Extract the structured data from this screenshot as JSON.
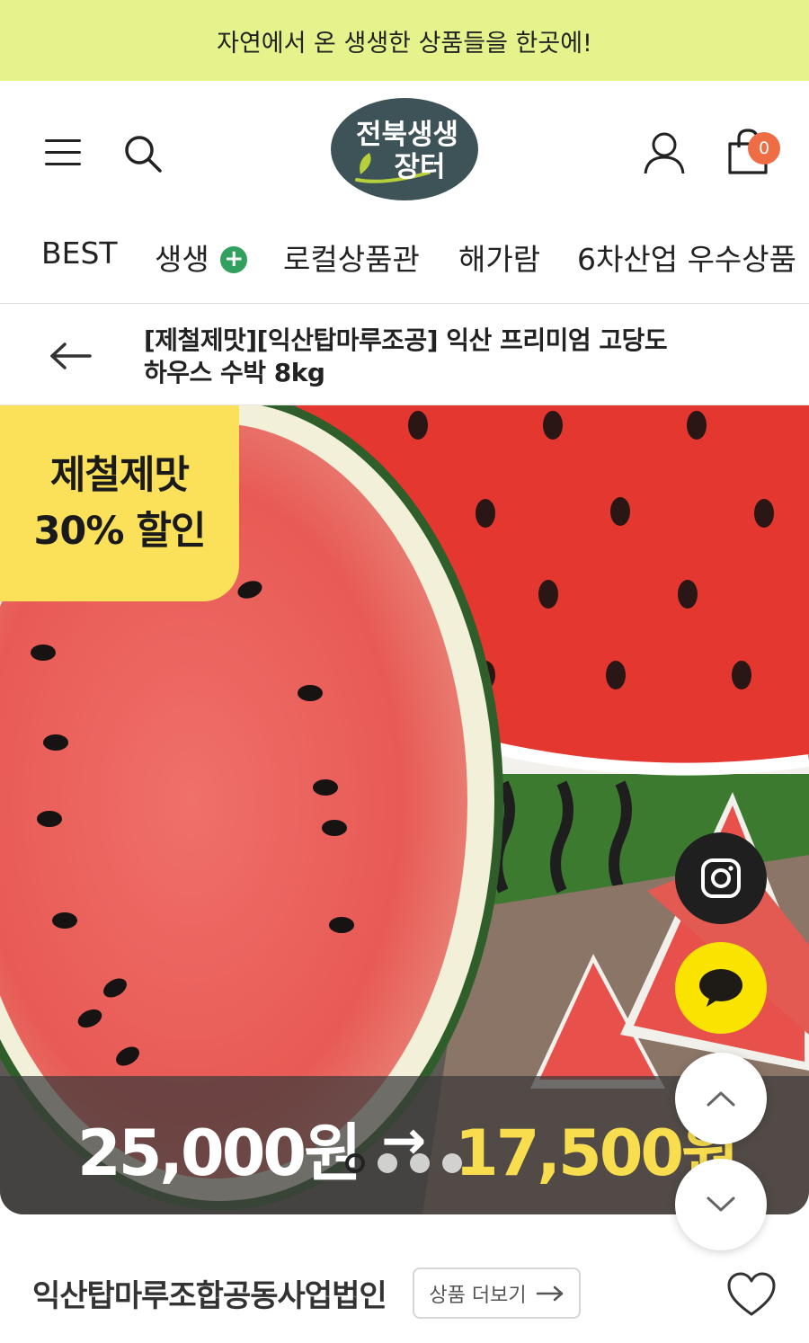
{
  "banner": {
    "text": "자연에서 온 생생한 상품들을 한곳에!"
  },
  "header": {
    "logo_text_line1": "전북생생",
    "logo_text_line2": "장터",
    "cart_count": "0"
  },
  "nav": {
    "items": [
      {
        "label": "BEST"
      },
      {
        "label": "생생",
        "badge": "+"
      },
      {
        "label": "로컬상품관"
      },
      {
        "label": "해가람"
      },
      {
        "label": "6차산업 우수상품"
      }
    ]
  },
  "product": {
    "title": "[제철제맛][익산탑마루조공] 익산 프리미엄 고당도 하우스 수박 8kg",
    "sale_badge_line1": "제철제맛",
    "sale_badge_line2": "30% 할인",
    "original_price": "25,000원",
    "arrow": "→",
    "sale_price": "17,500원",
    "carousel": {
      "total": 4,
      "active": 1
    }
  },
  "seller": {
    "name": "익산탑마루조합공동사업법인",
    "more_label": "상품 더보기"
  },
  "colors": {
    "banner_bg": "#e6f38c",
    "sale_badge": "#fbe15a",
    "sale_price": "#f8dd4f",
    "cart_badge": "#ef6d45",
    "plus_badge": "#32a05e",
    "kakao": "#fbe300"
  },
  "icons": [
    "menu-icon",
    "search-icon",
    "user-icon",
    "cart-icon",
    "back-arrow-icon",
    "instagram-icon",
    "chat-icon",
    "chevron-up-icon",
    "chevron-down-icon",
    "arrow-right-icon",
    "heart-icon"
  ]
}
